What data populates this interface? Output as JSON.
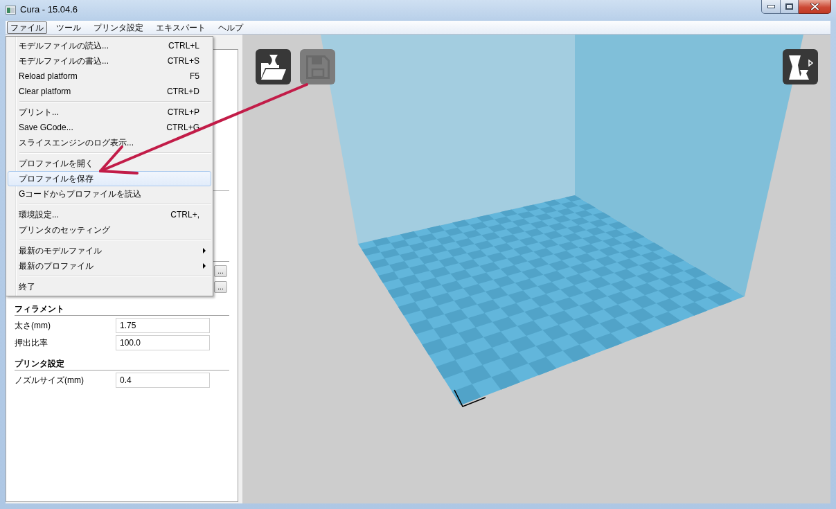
{
  "window": {
    "title": "Cura - 15.04.6"
  },
  "menu_bar": [
    {
      "label": "ファイル",
      "selected": true
    },
    {
      "label": "ツール",
      "selected": false
    },
    {
      "label": "プリンタ設定",
      "selected": false
    },
    {
      "label": "エキスパート",
      "selected": false
    },
    {
      "label": "ヘルプ",
      "selected": false
    }
  ],
  "file_menu": {
    "groups": [
      [
        {
          "label": "モデルファイルの読込...",
          "shortcut": "CTRL+L",
          "selected": false,
          "submenu": false
        },
        {
          "label": "モデルファイルの書込...",
          "shortcut": "CTRL+S",
          "selected": false,
          "submenu": false
        },
        {
          "label": "Reload platform",
          "shortcut": "F5",
          "selected": false,
          "submenu": false
        },
        {
          "label": "Clear platform",
          "shortcut": "CTRL+D",
          "selected": false,
          "submenu": false
        }
      ],
      [
        {
          "label": "プリント...",
          "shortcut": "CTRL+P",
          "selected": false,
          "submenu": false
        },
        {
          "label": "Save GCode...",
          "shortcut": "CTRL+G",
          "selected": false,
          "submenu": false
        },
        {
          "label": "スライスエンジンのログ表示...",
          "selected": false,
          "submenu": false
        }
      ],
      [
        {
          "label": "プロファイルを開く",
          "selected": false,
          "submenu": false
        },
        {
          "label": "プロファイルを保存",
          "selected": true,
          "submenu": false
        },
        {
          "label": "Gコードからプロファイルを読込",
          "selected": false,
          "submenu": false
        }
      ],
      [
        {
          "label": "環境設定...",
          "shortcut": "CTRL+,",
          "selected": false,
          "submenu": false
        },
        {
          "label": "プリンタのセッティング",
          "selected": false,
          "submenu": false
        }
      ],
      [
        {
          "label": "最新のモデルファイル",
          "selected": false,
          "submenu": true
        },
        {
          "label": "最新のプロファイル",
          "selected": false,
          "submenu": true
        }
      ],
      [
        {
          "label": "終了",
          "selected": false,
          "submenu": false
        }
      ]
    ]
  },
  "settings_panel": {
    "browse_buttons": [
      "...",
      "..."
    ],
    "sections": [
      {
        "title": "フィラメント",
        "fields": [
          {
            "label": "太さ(mm)",
            "value": "1.75"
          },
          {
            "label": "押出比率",
            "value": "100.0"
          }
        ]
      },
      {
        "title": "プリンタ設定",
        "fields": [
          {
            "label": "ノズルサイズ(mm)",
            "value": "0.4"
          }
        ]
      }
    ]
  },
  "viewport": {
    "tool_buttons": [
      {
        "kind": "load",
        "disabled": false
      },
      {
        "kind": "save",
        "disabled": true
      }
    ],
    "view_buttons": [
      {
        "kind": "view_mode",
        "disabled": false
      }
    ]
  }
}
